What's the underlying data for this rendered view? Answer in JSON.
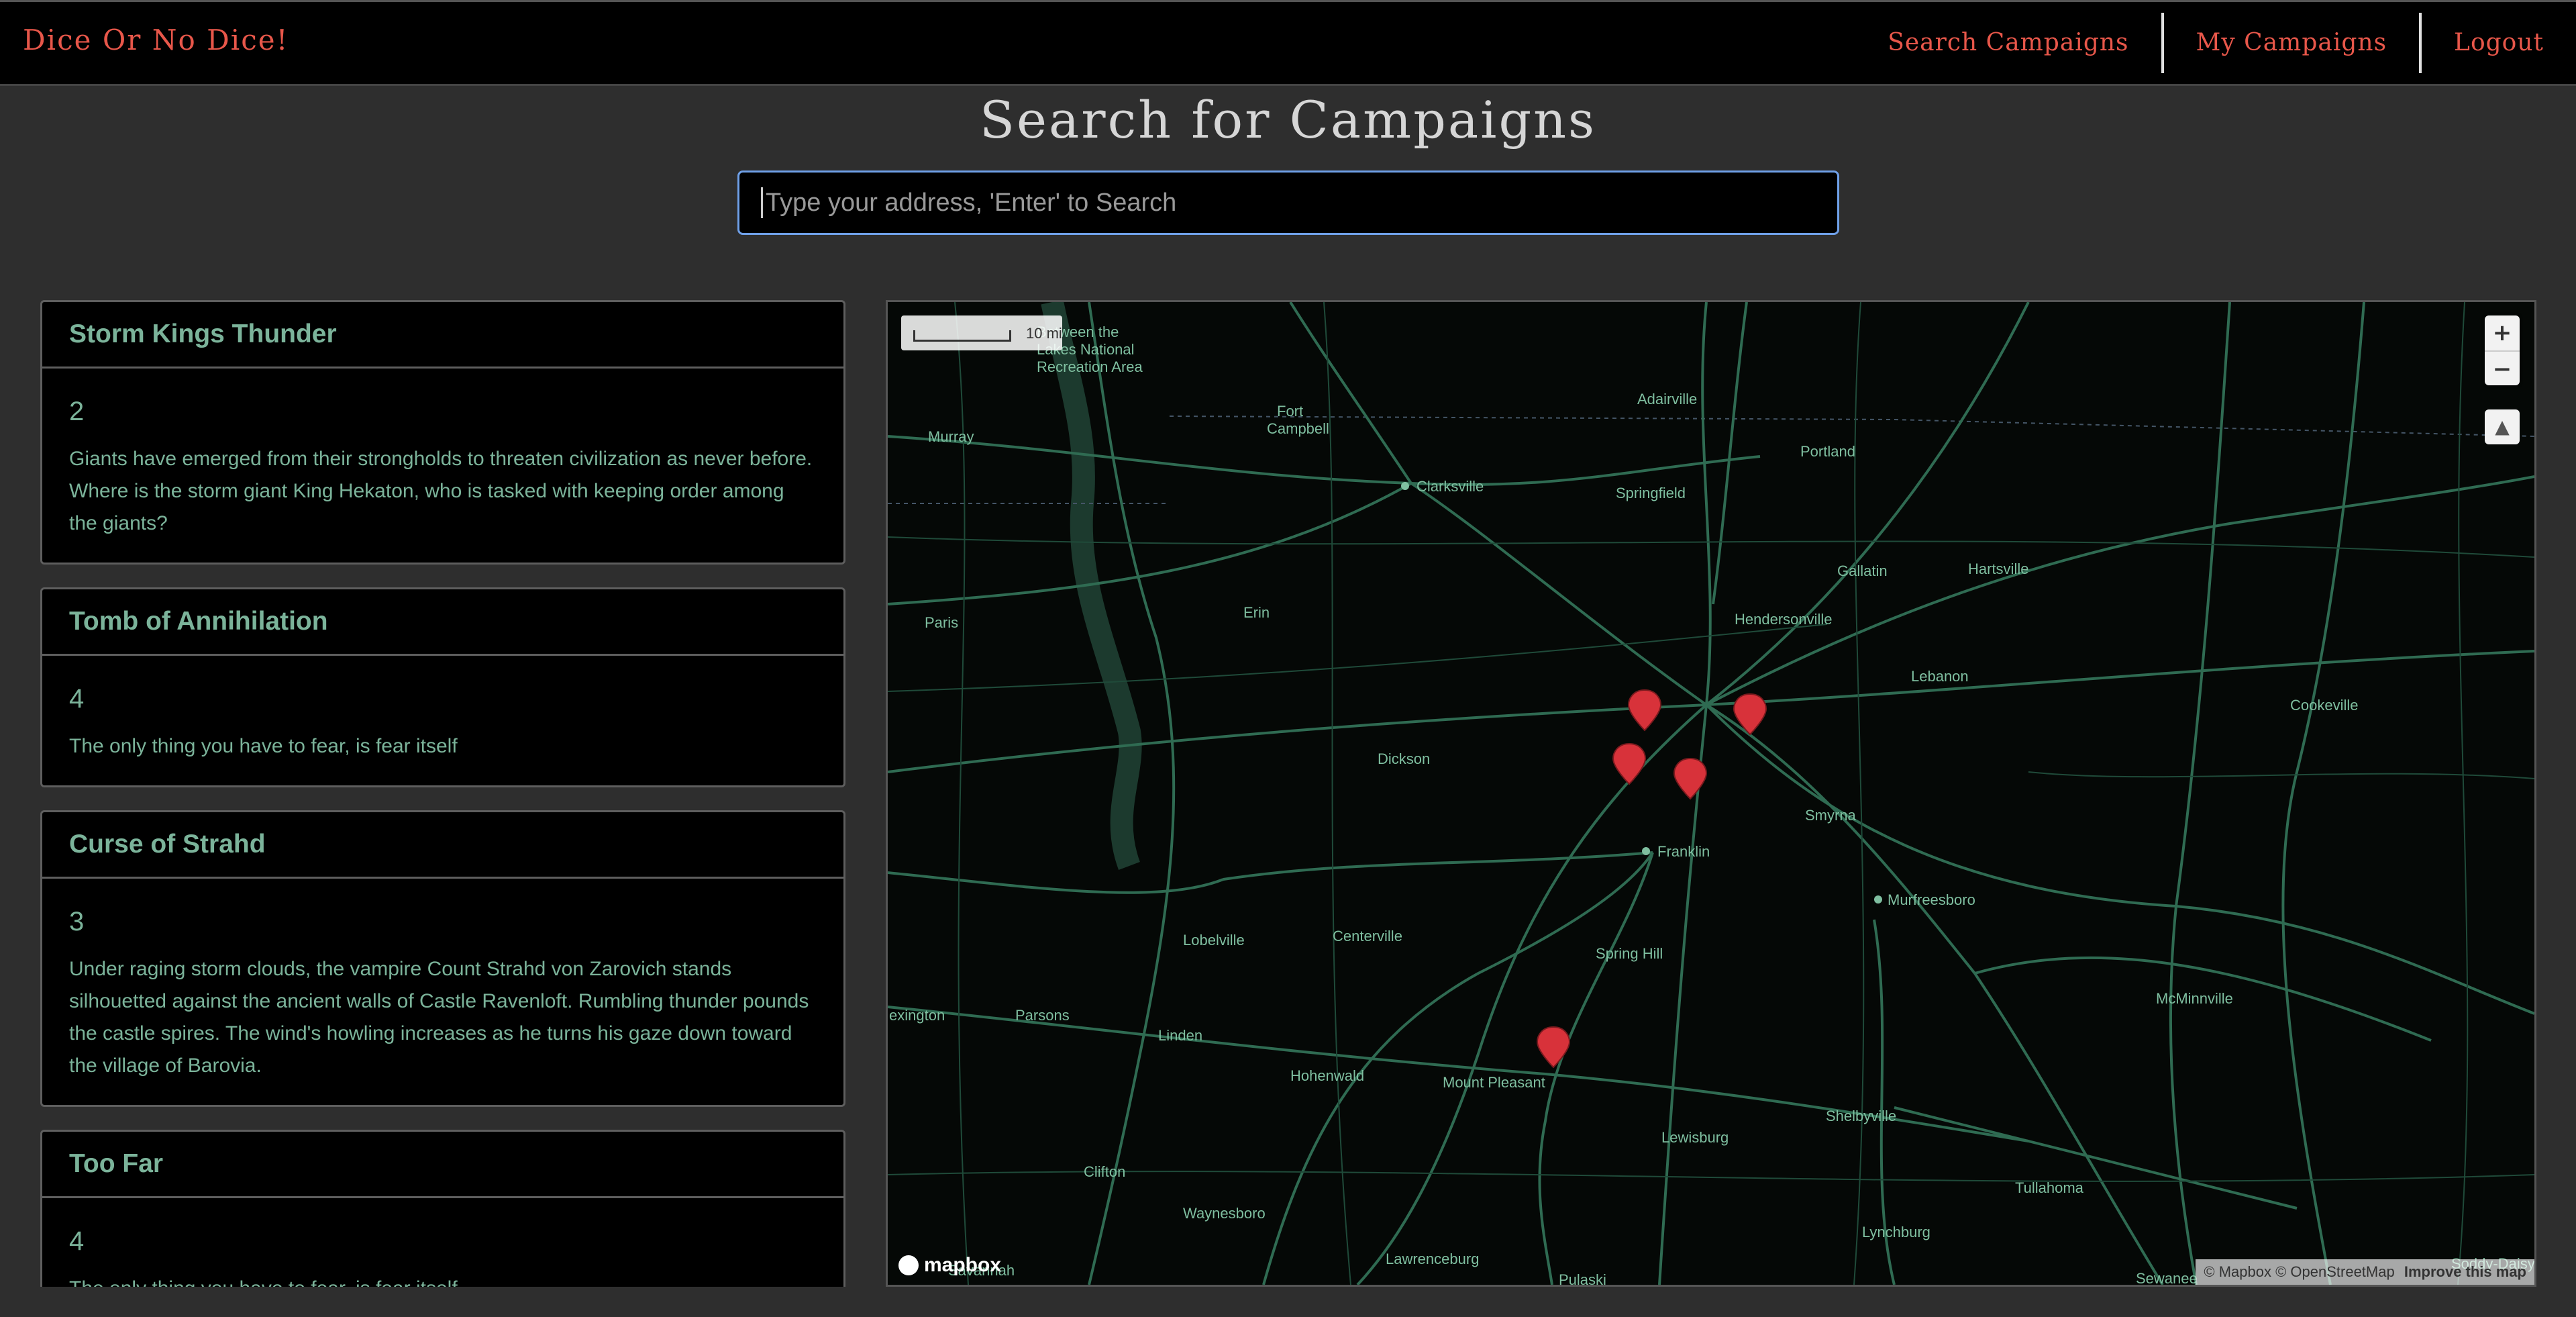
{
  "navbar": {
    "brand": "Dice Or No Dice!",
    "links": [
      "Search Campaigns",
      "My Campaigns",
      "Logout"
    ]
  },
  "page": {
    "title": "Search for Campaigns",
    "search_placeholder": "Type your address, 'Enter' to Search"
  },
  "campaigns": [
    {
      "name": "Storm Kings Thunder",
      "players": "2",
      "description": "Giants have emerged from their strongholds to threaten civilization as never before. Where is the storm giant King Hekaton, who is tasked with keeping order among the giants?"
    },
    {
      "name": "Tomb of Annihilation",
      "players": "4",
      "description": "The only thing you have to fear, is fear itself"
    },
    {
      "name": "Curse of Strahd",
      "players": "3",
      "description": "Under raging storm clouds, the vampire Count Strahd von Zarovich stands silhouetted against the ancient walls of Castle Ravenloft. Rumbling thunder pounds the castle spires. The wind's howling increases as he turns his gaze down toward the village of Barovia."
    },
    {
      "name": "Too Far",
      "players": "4",
      "description": "The only thing you have to fear, is fear itself"
    }
  ],
  "map": {
    "zoom_in": "+",
    "zoom_out": "−",
    "compass": "▲",
    "scale": "10 mi",
    "logo": "mapbox",
    "attribution": "© Mapbox © OpenStreetMap",
    "improve": "Improve this map",
    "labels": {
      "lbl_between": "Between the",
      "lbl_lakes": "Lakes National",
      "lbl_recreation": "Recreation Area",
      "lbl_murray": "Murray",
      "lbl_fort": "Fort",
      "lbl_campbell": "Campbell",
      "lbl_adairville": "Adairville",
      "lbl_portland": "Portland",
      "lbl_clarksville": "Clarksville",
      "lbl_springfield": "Springfield",
      "lbl_gallatin": "Gallatin",
      "lbl_hartsville": "Hartsville",
      "lbl_paris": "Paris",
      "lbl_erin": "Erin",
      "lbl_hendersonville": "Hendersonville",
      "lbl_lebanon": "Lebanon",
      "lbl_cookeville": "Cookeville",
      "lbl_dickson": "Dickson",
      "lbl_smyrna": "Smyrna",
      "lbl_franklin": "Franklin",
      "lbl_murfreesboro": "Murfreesboro",
      "lbl_lobelville": "Lobelville",
      "lbl_centerville": "Centerville",
      "lbl_springhill": "Spring Hill",
      "lbl_lexington": "exington",
      "lbl_parsons": "Parsons",
      "lbl_linden": "Linden",
      "lbl_hohenwald": "Hohenwald",
      "lbl_mountpleasant": "Mount Pleasant",
      "lbl_mcminnville": "McMinnville",
      "lbl_shelbyville": "Shelbyville",
      "lbl_lewisburg": "Lewisburg",
      "lbl_tullahoma": "Tullahoma",
      "lbl_clifton": "Clifton",
      "lbl_waynesboro": "Waynesboro",
      "lbl_lynchburg": "Lynchburg",
      "lbl_lawrenceburg": "Lawrenceburg",
      "lbl_savannah": "Savannah",
      "lbl_pulaski": "Pulaski",
      "lbl_sewanee": "Sewanee",
      "lbl_soddydaisy": "Soddy-Daisy"
    }
  },
  "colors": {
    "accent": "#e8574a",
    "card_text": "#7bb39a",
    "road": "#2f6b52",
    "marker": "#d8323a"
  }
}
